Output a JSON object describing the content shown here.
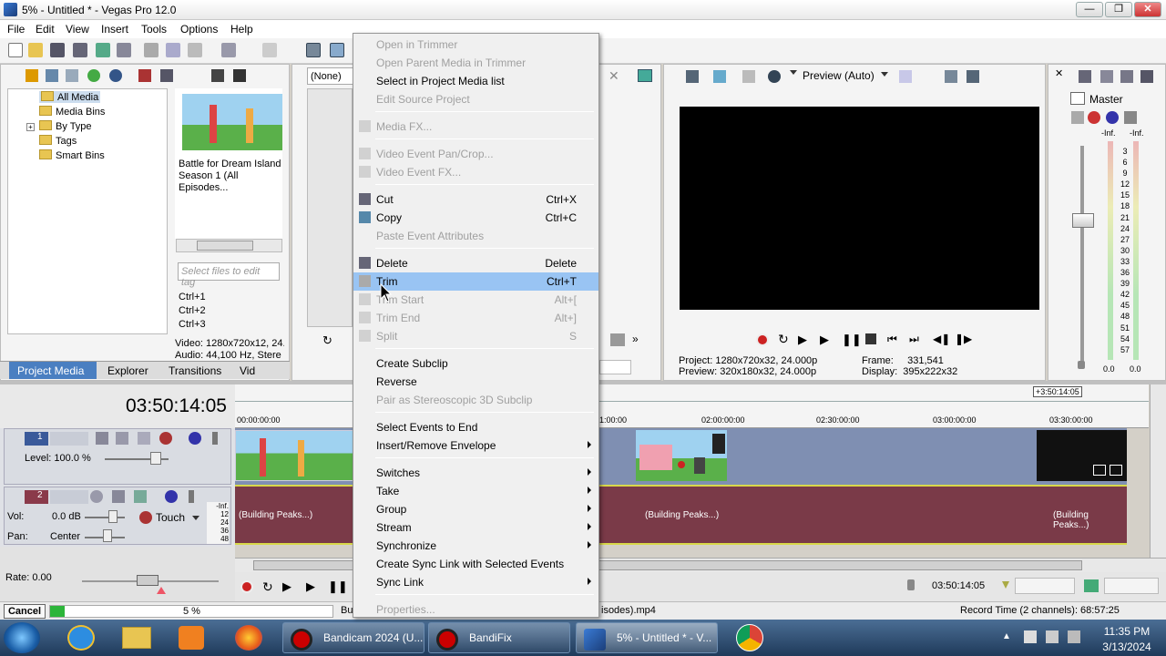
{
  "window": {
    "title": "5% - Untitled * - Vegas Pro 12.0",
    "minimize": "—",
    "maximize": "❐",
    "close": "✕"
  },
  "menu": [
    "File",
    "Edit",
    "View",
    "Insert",
    "Tools",
    "Options",
    "Help"
  ],
  "media": {
    "tree": [
      "All Media",
      "Media Bins",
      "By Type",
      "Tags",
      "Smart Bins"
    ],
    "thumb_caption": "Battle for Dream Island Season 1 (All Episodes...",
    "tag_placeholder": "Select files to edit tag",
    "shortcuts": [
      "Ctrl+1",
      "Ctrl+2",
      "Ctrl+3"
    ],
    "info_video": "Video: 1280x720x12, 24.",
    "info_audio": "Audio: 44,100 Hz, Stere",
    "tabs": [
      "Project Media",
      "Explorer",
      "Transitions",
      "Vid"
    ]
  },
  "trimmer": {
    "dropdown": "(None)"
  },
  "preview": {
    "label": "Preview (Auto)",
    "project_label": "Project:",
    "project_val": "1280x720x32, 24.000p",
    "preview_label": "Preview:",
    "preview_val": "320x180x32, 24.000p",
    "frame_label": "Frame:",
    "frame_val": "331,541",
    "display_label": "Display:",
    "display_val": "395x222x32"
  },
  "master": {
    "title": "Master",
    "inf_l": "-Inf.",
    "inf_r": "-Inf.",
    "scale": [
      "3",
      "6",
      "9",
      "12",
      "15",
      "18",
      "21",
      "24",
      "27",
      "30",
      "33",
      "36",
      "39",
      "42",
      "45",
      "48",
      "51",
      "54",
      "57"
    ],
    "val_l": "0.0",
    "val_r": "0.0"
  },
  "timeline": {
    "timecode": "03:50:14:05",
    "marker": "+3:50:14:05",
    "ruler": [
      "00:00:00:00",
      "1:00:00",
      "02:00:00:00",
      "02:30:00:00",
      "03:00:00:00",
      "03:30:00:00"
    ],
    "v_track_num": "1",
    "v_level": "Level: 100.0 %",
    "a_track_num": "2",
    "a_vol": "Vol:",
    "a_vol_val": "0.0 dB",
    "a_touch": "Touch",
    "a_pan": "Pan:",
    "a_pan_val": "Center",
    "a_meter": [
      "-Inf.",
      "12",
      "24",
      "36",
      "48"
    ],
    "peaks": "(Building Peaks...)",
    "rate": "Rate: 0.00",
    "pos": "03:50:14:05"
  },
  "status": {
    "cancel": "Cancel",
    "progress_pct": "5 %",
    "progress_fraction": 0.05,
    "file_frag_left": "Bu",
    "file_frag": "isodes).mp4",
    "record_time": "Record Time (2 channels): 68:57:25"
  },
  "context_menu": [
    {
      "label": "Open in Trimmer",
      "disabled": true
    },
    {
      "label": "Open Parent Media in Trimmer",
      "disabled": true
    },
    {
      "label": "Select in Project Media list"
    },
    {
      "label": "Edit Source Project",
      "disabled": true
    },
    {
      "label": "Media FX...",
      "disabled": true
    },
    {
      "label": "Video Event Pan/Crop...",
      "disabled": true
    },
    {
      "label": "Video Event FX...",
      "disabled": true
    },
    {
      "label": "Cut",
      "key": "Ctrl+X"
    },
    {
      "label": "Copy",
      "key": "Ctrl+C"
    },
    {
      "label": "Paste Event Attributes",
      "disabled": true
    },
    {
      "label": "Delete",
      "key": "Delete"
    },
    {
      "label": "Trim",
      "key": "Ctrl+T"
    },
    {
      "label": "Trim Start",
      "key": "Alt+[",
      "disabled": true
    },
    {
      "label": "Trim End",
      "key": "Alt+]",
      "disabled": true
    },
    {
      "label": "Split",
      "key": "S",
      "disabled": true
    },
    {
      "label": "Create Subclip"
    },
    {
      "label": "Reverse"
    },
    {
      "label": "Pair as Stereoscopic 3D Subclip",
      "disabled": true
    },
    {
      "label": "Select Events to End"
    },
    {
      "label": "Insert/Remove Envelope"
    },
    {
      "label": "Switches"
    },
    {
      "label": "Take"
    },
    {
      "label": "Group"
    },
    {
      "label": "Stream"
    },
    {
      "label": "Synchronize"
    },
    {
      "label": "Create Sync Link with Selected Events"
    },
    {
      "label": "Sync Link"
    },
    {
      "label": "Properties...",
      "disabled": true
    }
  ],
  "taskbar": {
    "items": [
      "Bandicam 2024 (U...",
      "BandiFix",
      "5% - Untitled * - V..."
    ],
    "time": "11:35 PM",
    "date": "3/13/2024"
  }
}
